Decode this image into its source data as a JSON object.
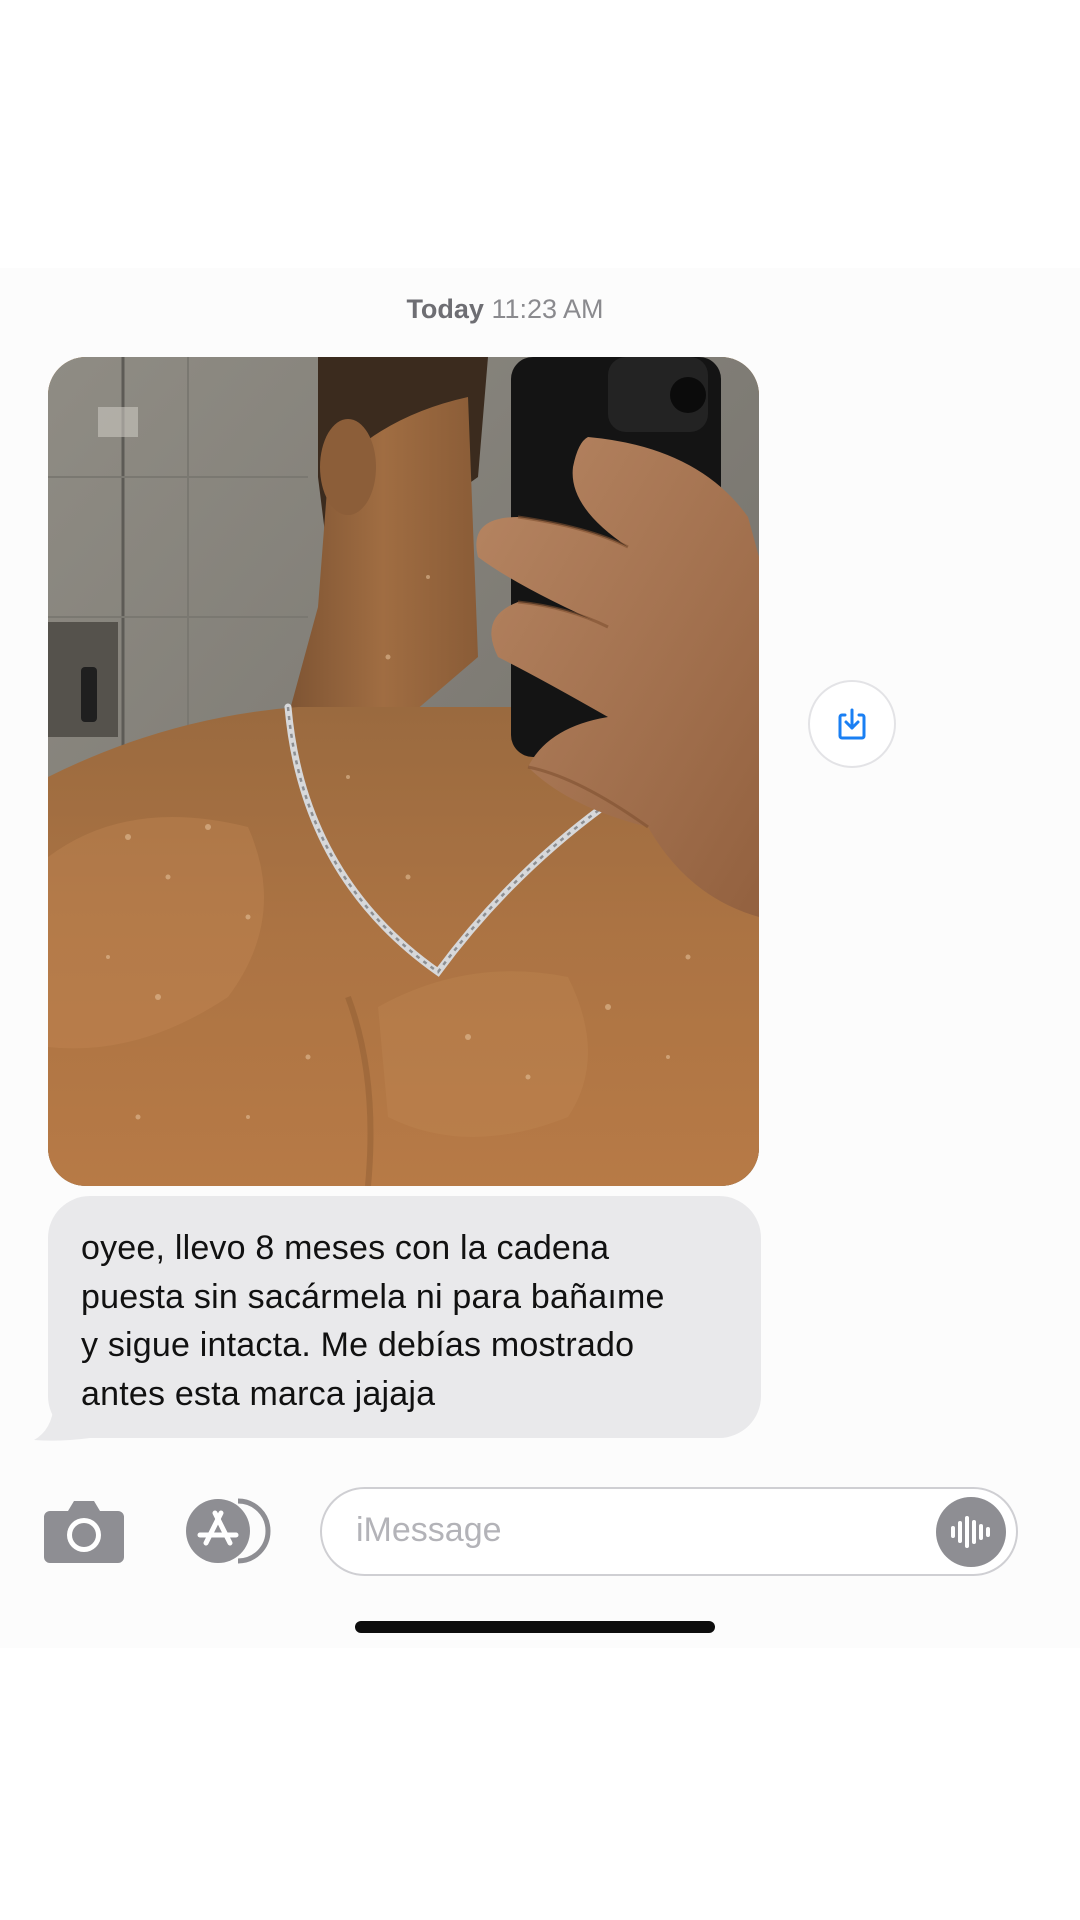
{
  "header": {
    "timestamp_day": "Today",
    "timestamp_time": "11:23 AM"
  },
  "thread": {
    "photo_message": {
      "description_icon": "photo"
    },
    "text_message": {
      "lines": [
        "oyee, llevo 8 meses con la cadena",
        "puesta sin sacármela ni para bañaıme",
        "y sigue intacta. Me debías mostrado",
        "antes esta marca jajaja"
      ]
    }
  },
  "composer": {
    "placeholder": "iMessage",
    "camera_icon": "camera-icon",
    "apps_icon": "app-store-icon",
    "audio_icon": "waveform-icon"
  },
  "colors": {
    "incoming_bubble": "#e9e9eb",
    "accent": "#1a7ff3",
    "icon_gray": "#8e8e93"
  }
}
